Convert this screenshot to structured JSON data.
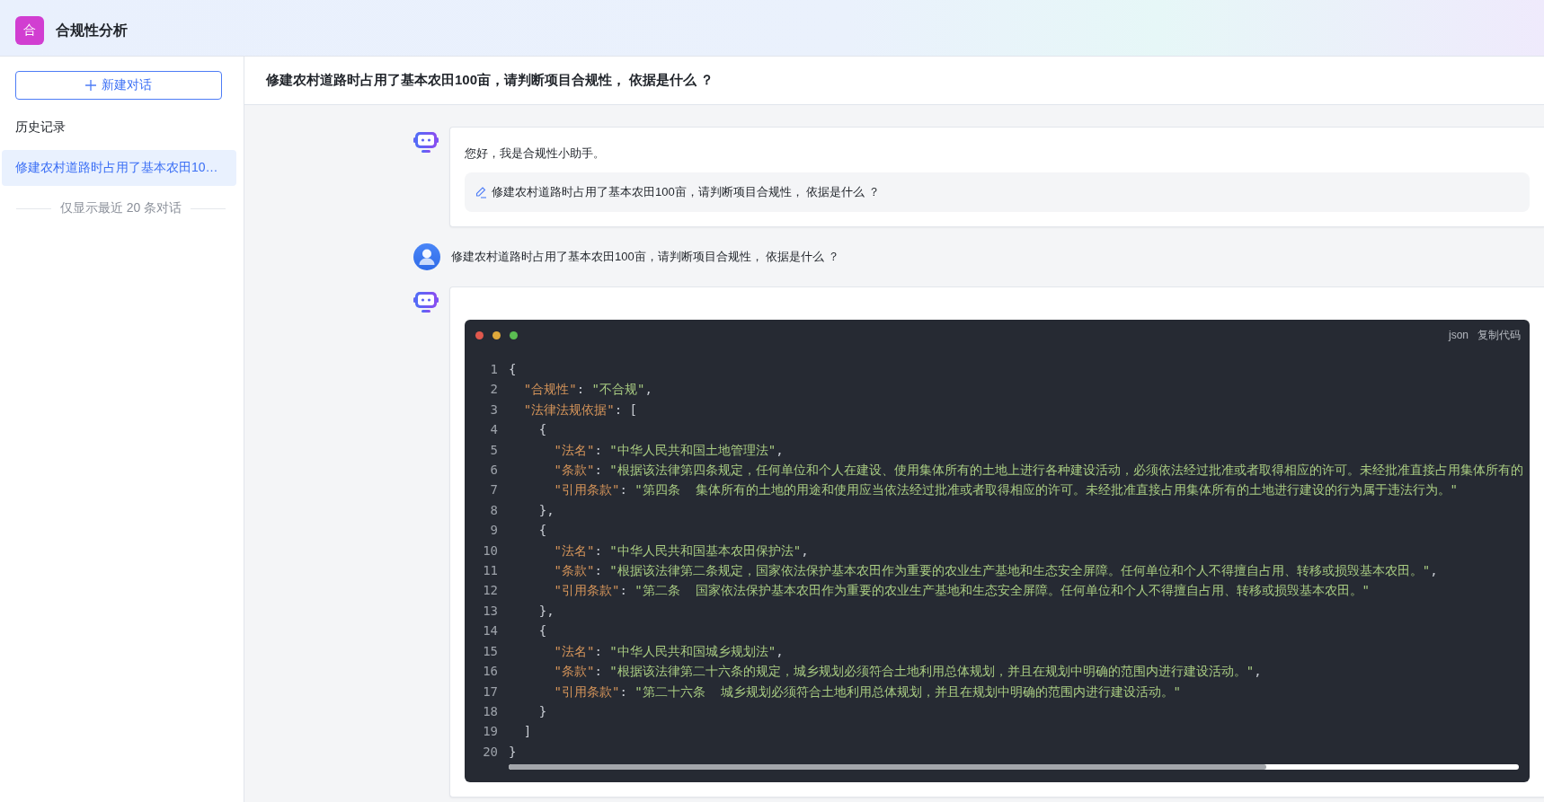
{
  "app": {
    "logo": "合",
    "title": "合规性分析"
  },
  "sidebar": {
    "new_button": "新建对话",
    "history_label": "历史记录",
    "items": [
      {
        "title": "修建农村道路时占用了基本农田10…",
        "selected": true
      }
    ],
    "footer_note": "仅显示最近 20 条对话"
  },
  "conversation": {
    "title": "修建农村道路时占用了基本农田100亩，请判断项目合规性， 依据是什么 ？",
    "messages": [
      {
        "kind": "bot",
        "text": "您好，我是合规性小助手。",
        "suggestion": "修建农村道路时占用了基本农田100亩，请判断项目合规性， 依据是什么 ？"
      },
      {
        "kind": "user",
        "text": "修建农村道路时占用了基本农田100亩，请判断项目合规性， 依据是什么 ？"
      },
      {
        "kind": "bot",
        "code": {
          "language": "json",
          "copy_label": "复制代码",
          "lines": [
            {
              "number": "1",
              "text": "{"
            },
            {
              "number": "2",
              "text": "  \"合规性\": \"不合规\","
            },
            {
              "number": "3",
              "text": "  \"法律法规依据\": ["
            },
            {
              "number": "4",
              "text": "    {"
            },
            {
              "number": "5",
              "text": "      \"法名\": \"中华人民共和国土地管理法\","
            },
            {
              "number": "6",
              "text": "      \"条款\": \"根据该法律第四条规定，任何单位和个人在建设、使用集体所有的土地上进行各种建设活动，必须依法经过批准或者取得相应的许可。未经批准直接占用集体所有的"
            },
            {
              "number": "7",
              "text": "      \"引用条款\": \"第四条  集体所有的土地的用途和使用应当依法经过批准或者取得相应的许可。未经批准直接占用集体所有的土地进行建设的行为属于违法行为。\""
            },
            {
              "number": "8",
              "text": "    },"
            },
            {
              "number": "9",
              "text": "    {"
            },
            {
              "number": "10",
              "text": "      \"法名\": \"中华人民共和国基本农田保护法\","
            },
            {
              "number": "11",
              "text": "      \"条款\": \"根据该法律第二条规定，国家依法保护基本农田作为重要的农业生产基地和生态安全屏障。任何单位和个人不得擅自占用、转移或损毁基本农田。\","
            },
            {
              "number": "12",
              "text": "      \"引用条款\": \"第二条  国家依法保护基本农田作为重要的农业生产基地和生态安全屏障。任何单位和个人不得擅自占用、转移或损毁基本农田。\""
            },
            {
              "number": "13",
              "text": "    },"
            },
            {
              "number": "14",
              "text": "    {"
            },
            {
              "number": "15",
              "text": "      \"法名\": \"中华人民共和国城乡规划法\","
            },
            {
              "number": "16",
              "text": "      \"条款\": \"根据该法律第二十六条的规定，城乡规划必须符合土地利用总体规划，并且在规划中明确的范围内进行建设活动。\","
            },
            {
              "number": "17",
              "text": "      \"引用条款\": \"第二十六条  城乡规划必须符合土地利用总体规划，并且在规划中明确的范围内进行建设活动。\""
            },
            {
              "number": "18",
              "text": "    }"
            },
            {
              "number": "19",
              "text": "  ]"
            },
            {
              "number": "20",
              "text": "}"
            }
          ]
        }
      }
    ]
  }
}
